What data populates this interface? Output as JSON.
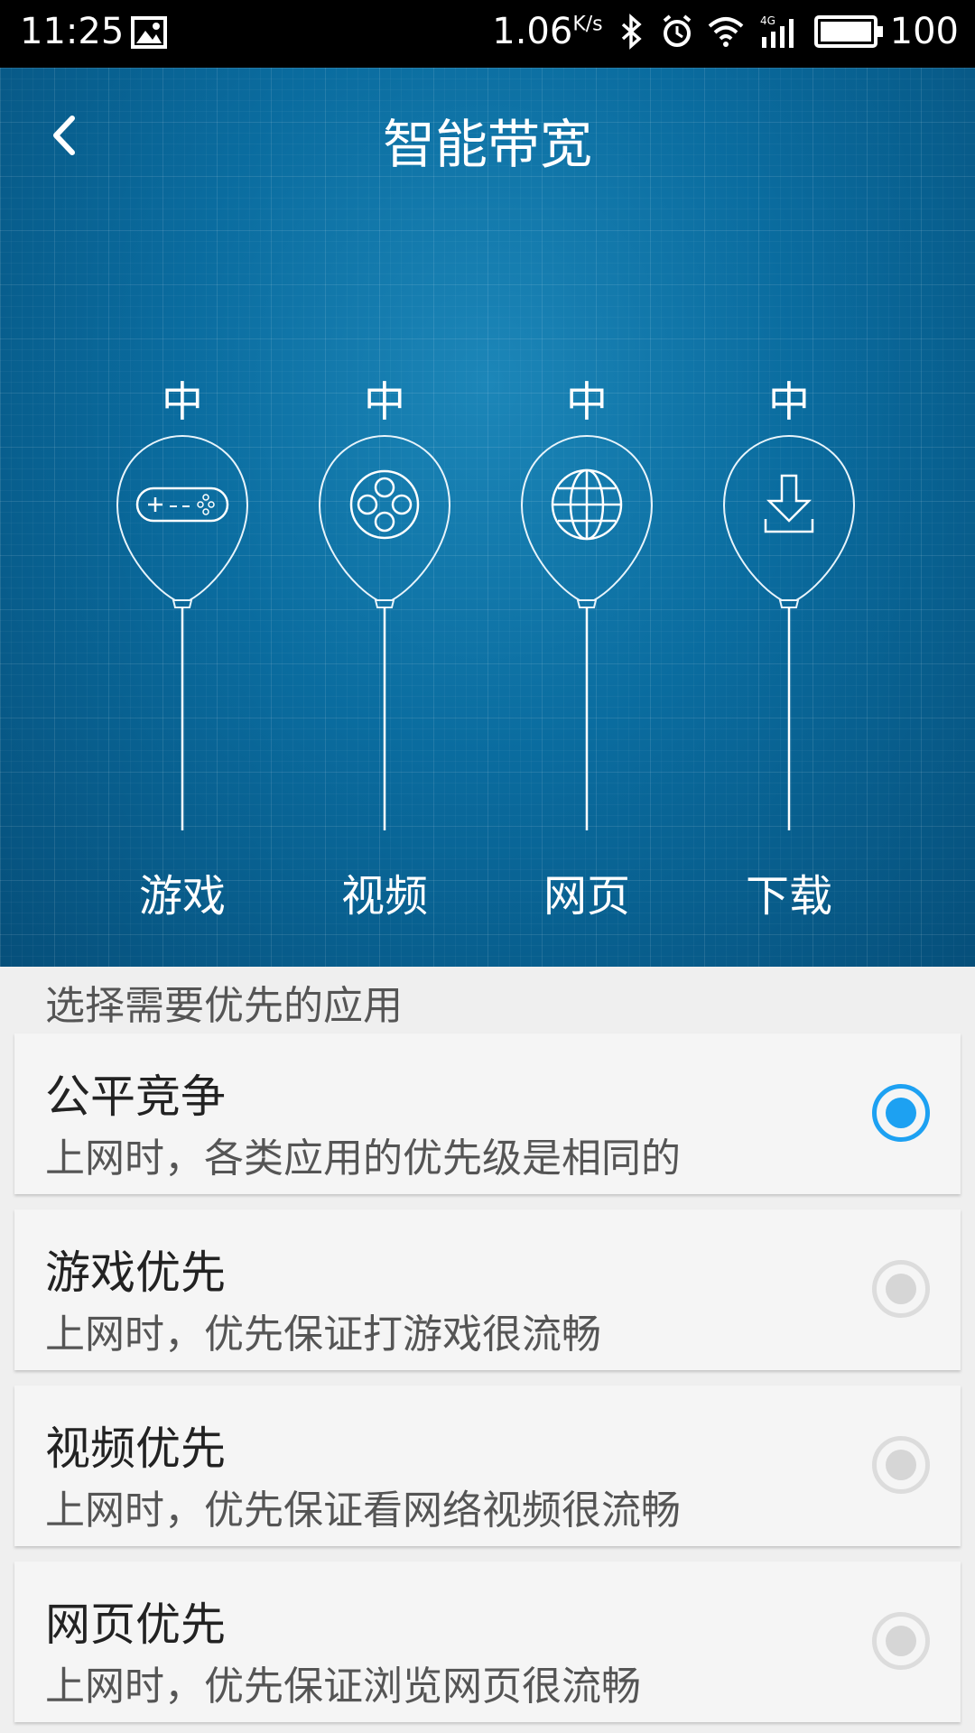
{
  "status_bar": {
    "time": "11:25",
    "net_speed": "1.06",
    "net_unit": "K/s",
    "battery": "100",
    "icons": [
      "image-icon",
      "bluetooth-icon",
      "alarm-icon",
      "wifi-icon",
      "signal-4g-icon",
      "battery-icon"
    ]
  },
  "header": {
    "title": "智能带宽",
    "back_icon": "back-arrow-icon"
  },
  "balloons": [
    {
      "level": "中",
      "label": "游戏",
      "icon": "gamepad-icon"
    },
    {
      "level": "中",
      "label": "视频",
      "icon": "video-icon"
    },
    {
      "level": "中",
      "label": "网页",
      "icon": "globe-icon"
    },
    {
      "level": "中",
      "label": "下载",
      "icon": "download-icon"
    }
  ],
  "section_label": "选择需要优先的应用",
  "options": [
    {
      "title": "公平竞争",
      "desc": "上网时，各类应用的优先级是相同的",
      "selected": true
    },
    {
      "title": "游戏优先",
      "desc": "上网时，优先保证打游戏很流畅",
      "selected": false
    },
    {
      "title": "视频优先",
      "desc": "上网时，优先保证看网络视频很流畅",
      "selected": false
    },
    {
      "title": "网页优先",
      "desc": "上网时，优先保证浏览网页很流畅",
      "selected": false
    }
  ],
  "colors": {
    "accent": "#1da1f2",
    "hero": "#0a6c9f"
  }
}
